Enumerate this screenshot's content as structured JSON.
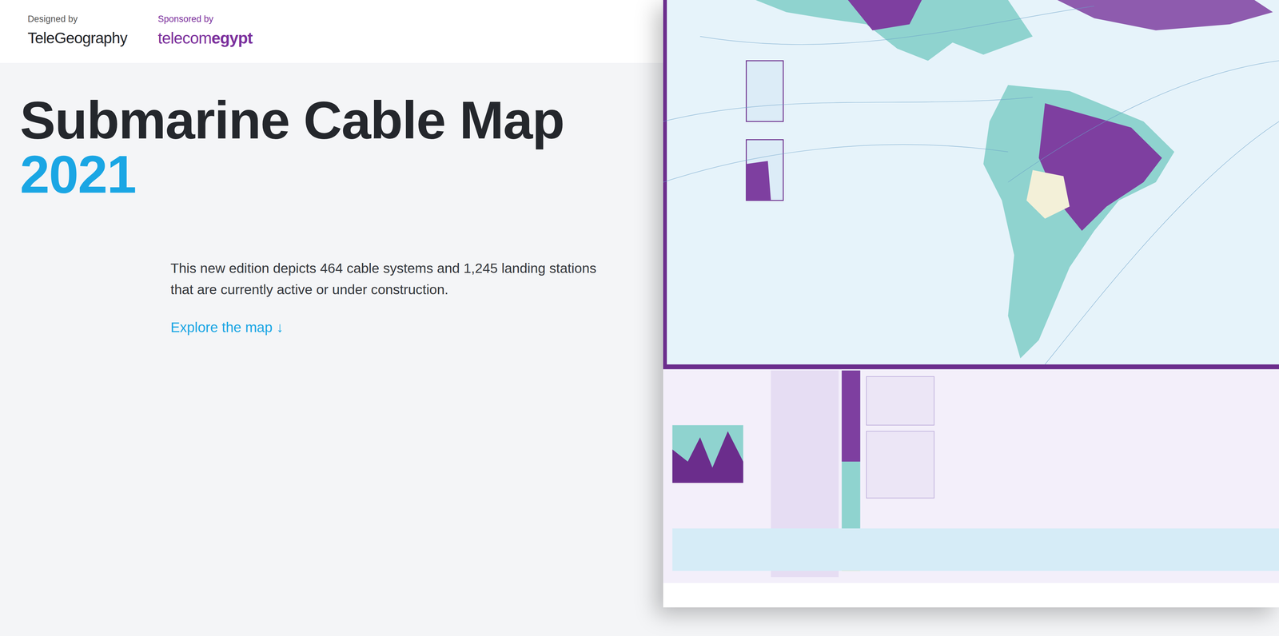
{
  "header": {
    "designed_by_label": "Designed by",
    "designed_by": "TeleGeography",
    "sponsored_by_label": "Sponsored by",
    "sponsored_by_parts": [
      "telecom",
      "egypt"
    ]
  },
  "hero": {
    "title": "Submarine Cable Map",
    "year": "2021",
    "description": "This new edition depicts 464 cable systems and 1,245 landing stations that are currently active or under construction.",
    "cta": "Explore the map",
    "cta_icon": "↓"
  }
}
